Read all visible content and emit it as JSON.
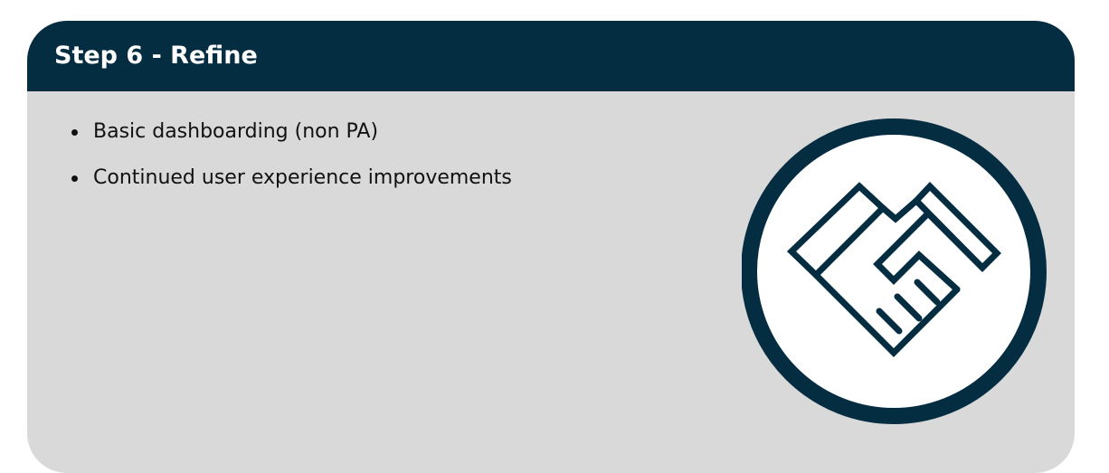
{
  "card": {
    "title": "Step 6 - Refine",
    "bullets": [
      "Basic dashboarding (non PA)",
      "Continued user experience improvements"
    ],
    "illustration_icon": "handshake-icon"
  },
  "colors": {
    "header_background": "#052d42",
    "card_background": "#d9d9d9",
    "icon_stroke": "#052d42",
    "title_text": "#ffffff",
    "body_text": "#111111"
  }
}
